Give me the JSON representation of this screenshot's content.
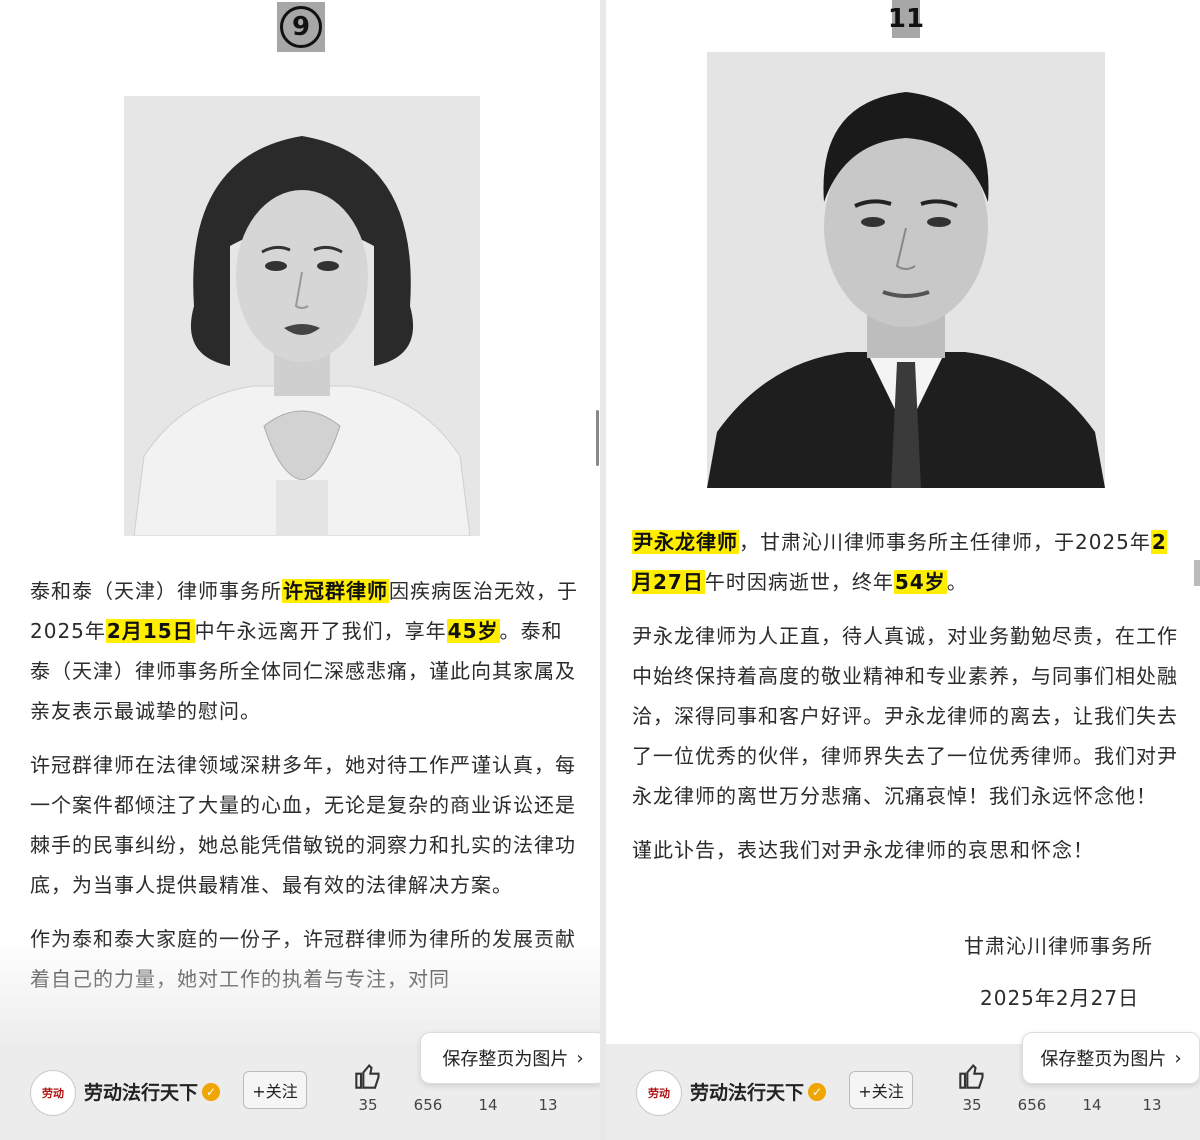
{
  "left": {
    "badge": "9",
    "paragraphs": {
      "p1": {
        "pre": "泰和泰（天津）律师事务所",
        "name": "许冠群律师",
        "mid": "因疾病医治无效，于2025年",
        "date": "2月15日",
        "mid2": "中午永远离开了我们，享年",
        "age": "45岁",
        "post": "。泰和泰（天津）律师事务所全体同仁深感悲痛，谨此向其家属及亲友表示最诚挚的慰问。"
      },
      "p2": "许冠群律师在法律领域深耕多年，她对待工作严谨认真，每一个案件都倾注了大量的心血，无论是复杂的商业诉讼还是棘手的民事纠纷，她总能凭借敏锐的洞察力和扎实的法律功底，为当事人提供最精准、最有效的法律解决方案。",
      "p3": "作为泰和泰大家庭的一份子，许冠群律师为律所的发展贡献着自己的力量，她对工作的执着与专注，对同"
    },
    "bottom": {
      "account": "劳动法行天下",
      "follow": "+关注",
      "stats": [
        "35",
        "656",
        "14",
        "13"
      ],
      "save": "保存整页为图片"
    }
  },
  "right": {
    "badge": "11",
    "paragraphs": {
      "p1": {
        "name": "尹永龙律师",
        "mid": "，甘肃沁川律师事务所主任律师，于2025年",
        "date": "2月27日",
        "mid2": "午时因病逝世，终年",
        "age": "54岁",
        "post": "。"
      },
      "p2": "尹永龙律师为人正直，待人真诚，对业务勤勉尽责，在工作中始终保持着高度的敬业精神和专业素养，与同事们相处融洽，深得同事和客户好评。尹永龙律师的离去，让我们失去了一位优秀的伙伴，律师界失去了一位优秀律师。我们对尹永龙律师的离世万分悲痛、沉痛哀悼！我们永远怀念他！",
      "p3": "谨此讣告，表达我们对尹永龙律师的哀思和怀念！"
    },
    "signature": {
      "org": "甘肃沁川律师事务所",
      "date": "2025年2月27日"
    },
    "bottom": {
      "account": "劳动法行天下",
      "follow": "+关注",
      "stats": [
        "35",
        "656",
        "14",
        "13"
      ],
      "save": "保存整页为图片"
    }
  },
  "icons": {
    "like": "thumbs-up-icon",
    "chevron": "chevron-right-icon",
    "verified": "verified-badge-icon"
  }
}
